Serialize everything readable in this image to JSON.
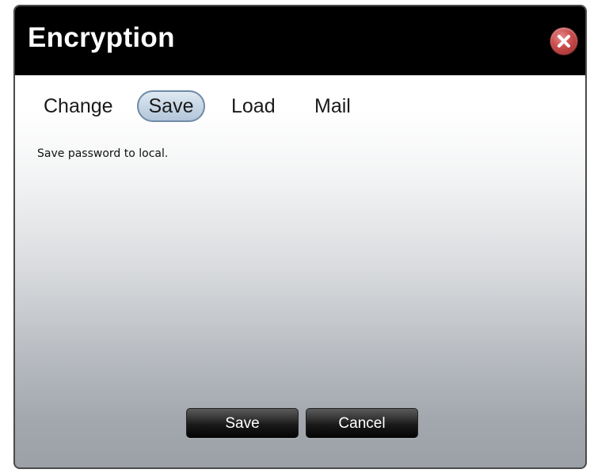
{
  "dialog": {
    "title": "Encryption",
    "close_icon": "close-icon"
  },
  "tabs": [
    {
      "label": "Change",
      "selected": false
    },
    {
      "label": "Save",
      "selected": true
    },
    {
      "label": "Load",
      "selected": false
    },
    {
      "label": "Mail",
      "selected": false
    }
  ],
  "content": {
    "description": "Save password to local."
  },
  "footer": {
    "save_label": "Save",
    "cancel_label": "Cancel"
  },
  "colors": {
    "titlebar": "#000000",
    "close_button": "#c84b4b",
    "selected_tab": "#c5d5e4"
  }
}
